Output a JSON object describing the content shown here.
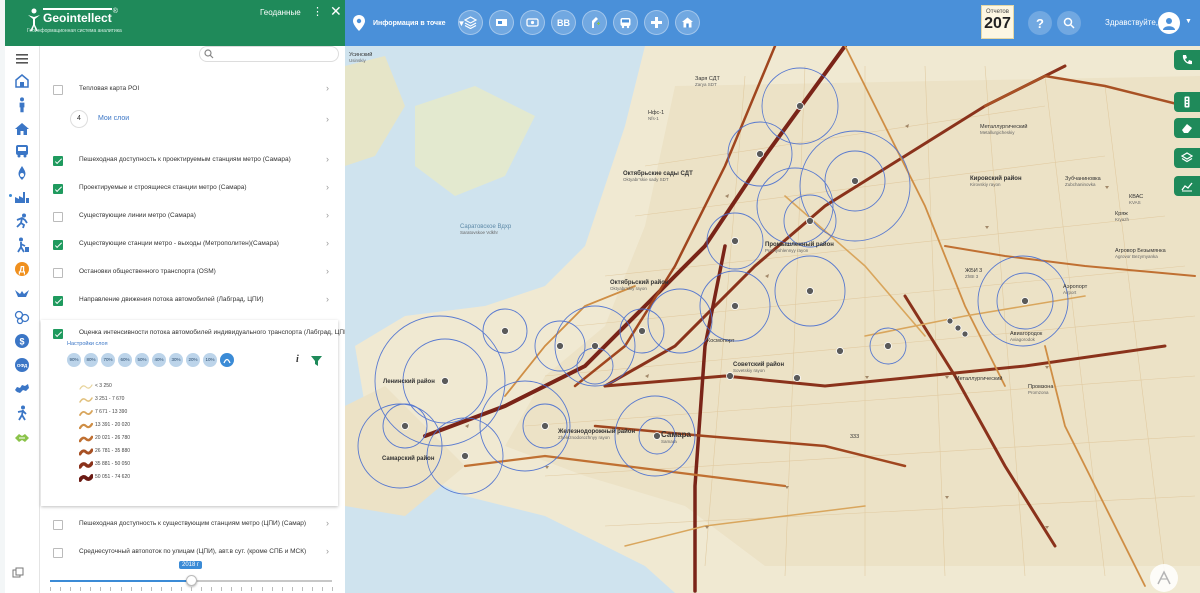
{
  "brand": {
    "name": "Geointellect",
    "trademark": "®",
    "subtitle": "Геоинформационная система аналитика",
    "panel_title": "Геоданные",
    "menu_glyph": "⋮",
    "close_glyph": "✕"
  },
  "topbar": {
    "mode_label": "Информация в точке",
    "mode_caret": "▼",
    "tool_bb_label": "BB",
    "reports_label": "Отчетов",
    "reports_count": "207",
    "help_glyph": "?",
    "greeting": "Здравствуйте,",
    "avatar_caret": "▼",
    "tools": [
      "layers-icon",
      "film-icon",
      "wallet-icon",
      "bb-icon",
      "pin-plus-icon",
      "bus-icon",
      "crosshair-icon",
      "home-icon"
    ]
  },
  "sidebar_icons": [
    "menu-icon",
    "building-icon",
    "person-icon",
    "house-icon",
    "bus-icon",
    "drop-icon",
    "factory-icon",
    "runner-icon",
    "walker-icon",
    "d-badge-icon",
    "bird-icon",
    "bubbles-icon",
    "dollar-icon",
    "ofd-icon",
    "map-russia-icon",
    "person-walk-icon",
    "handshake-icon"
  ],
  "search": {
    "placeholder": ""
  },
  "mylayers": {
    "count": "4",
    "label": "Мои слои"
  },
  "layers": [
    {
      "label": "Тепловая карта POI",
      "checked": false
    },
    {
      "label": "Пешеходная доступность к проектируемым станциям метро (Самара)",
      "checked": true
    },
    {
      "label": "Проектируемые и строящиеся станции метро (Самара)",
      "checked": true
    },
    {
      "label": "Существующие линии метро (Самара)",
      "checked": false
    },
    {
      "label": "Существующие станции метро - выходы (Метрополитен)(Самара)",
      "checked": true
    },
    {
      "label": "Остановки общественного транспорта (OSM)",
      "checked": false
    },
    {
      "label": "Направление движения потока автомобилей (Лабград, ЦПИ)",
      "checked": true
    },
    {
      "label": "Оценка интенсивности потока автомобилей индивидуального транспорта (Лабград, ЦПИ)",
      "checked": true
    },
    {
      "label": "Пешеходная доступность к существующим станциям метро (ЦПИ) (Самар)",
      "checked": false
    },
    {
      "label": "Среднесуточный автопоток по улицам (ЦПИ), авт.в сут. (кроме СПБ и МСК)",
      "checked": false
    }
  ],
  "layer_settings": {
    "label": "Настройки слоя",
    "opacity_options": [
      "90%",
      "80%",
      "70%",
      "60%",
      "50%",
      "40%",
      "30%",
      "20%",
      "10%"
    ],
    "info_glyph": "i"
  },
  "legend": [
    {
      "range": "< 3 250",
      "color": "#e7d39a",
      "width": 1.2
    },
    {
      "range": "3 251 - 7 670",
      "color": "#e1c07c",
      "width": 1.5
    },
    {
      "range": "7 671 - 13 390",
      "color": "#d9a65d",
      "width": 1.8
    },
    {
      "range": "13 391 - 20 020",
      "color": "#cf8e45",
      "width": 2.2
    },
    {
      "range": "20 021 - 26 780",
      "color": "#c07032",
      "width": 2.6
    },
    {
      "range": "26 781 - 35 880",
      "color": "#a85124",
      "width": 3.0
    },
    {
      "range": "35 881 - 50 050",
      "color": "#8a321b",
      "width": 3.4
    },
    {
      "range": "50 051 - 74 620",
      "color": "#6b1b14",
      "width": 3.8
    }
  ],
  "timeline": {
    "year_label": "2018 г",
    "position": 0.5
  },
  "map": {
    "labels": [
      {
        "text": "Усинский",
        "sub": "Usinskiy",
        "kind": "normal"
      },
      {
        "text": "Заря СДТ",
        "sub": "Zarya SDT",
        "kind": "normal"
      },
      {
        "text": "Нфс-1",
        "sub": "Nfs-1",
        "kind": "normal"
      },
      {
        "text": "Октябрьские сады СДТ",
        "sub": "Oktyabr'skie sady SDT",
        "kind": "bold"
      },
      {
        "text": "Саратовское Вдхр",
        "sub": "Saratovskoe Vdkhr",
        "kind": "water"
      },
      {
        "text": "Промышленный район",
        "sub": "Promyshlennyy rayon",
        "kind": "bold"
      },
      {
        "text": "Кировский район",
        "sub": "Kirovskiy rayon",
        "kind": "bold"
      },
      {
        "text": "Зубчаниновка",
        "sub": "Zubchaninovka",
        "kind": "normal"
      },
      {
        "text": "Металлургический",
        "sub": "Metallurgicheskiy",
        "kind": "normal"
      },
      {
        "text": "Октябрьский район",
        "sub": "Oktyabr'skiy rayon",
        "kind": "bold"
      },
      {
        "text": "Советский район",
        "sub": "Sovetskiy rayon",
        "kind": "bold"
      },
      {
        "text": "Железнодорожный район",
        "sub": "Zheleznodorozhnyy rayon",
        "kind": "bold"
      },
      {
        "text": "Самара",
        "sub": "Samara",
        "kind": "bigtown"
      },
      {
        "text": "Ленинский район",
        "sub": "",
        "kind": "bold"
      },
      {
        "text": "Самарский район",
        "sub": "",
        "kind": "bold"
      },
      {
        "text": "Аэропорт",
        "sub": "Airport",
        "kind": "normal"
      },
      {
        "text": "Авиагородок",
        "sub": "Aviagorodok",
        "kind": "normal"
      },
      {
        "text": "ЖБИ 3",
        "sub": "ZhBI 3",
        "kind": "normal"
      },
      {
        "text": "Кряж",
        "sub": "Kryazh",
        "kind": "normal"
      },
      {
        "text": "Промзона",
        "sub": "Promzona",
        "kind": "normal"
      },
      {
        "text": "КВАС",
        "sub": "KVAS",
        "kind": "normal"
      },
      {
        "text": "Агровор Безымянка",
        "sub": "Agrovor Bezymyanka",
        "kind": "normal"
      },
      {
        "text": "Металлургический",
        "sub": "",
        "kind": "normal"
      },
      {
        "text": "Космопорт",
        "sub": "",
        "kind": "normal"
      },
      {
        "text": "333",
        "sub": "",
        "kind": "normal"
      }
    ]
  }
}
